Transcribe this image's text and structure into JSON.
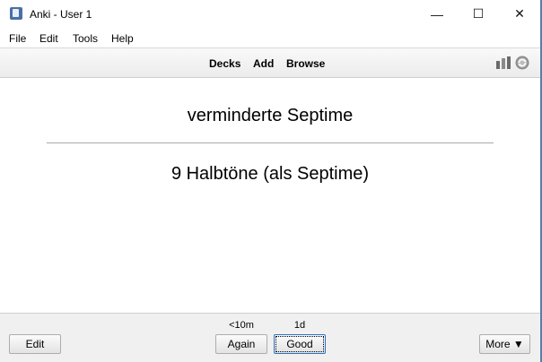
{
  "window": {
    "title": "Anki - User 1",
    "icons": {
      "app": "anki-icon",
      "minimize": "minimize-icon",
      "maximize": "maximize-icon",
      "close": "close-icon"
    },
    "controls": {
      "minimize": "—",
      "maximize": "☐",
      "close": "✕"
    }
  },
  "menu": {
    "file": "File",
    "edit": "Edit",
    "tools": "Tools",
    "help": "Help"
  },
  "toolbar": {
    "decks": "Decks",
    "add": "Add",
    "browse": "Browse",
    "stats_icon": "stats-icon",
    "sync_icon": "sync-icon"
  },
  "card": {
    "front": "verminderte Septime",
    "back": "9 Halbtöne (als Septime)"
  },
  "bottom": {
    "edit": "Edit",
    "again": {
      "label": "Again",
      "interval": "<10m"
    },
    "good": {
      "label": "Good",
      "interval": "1d"
    },
    "more": "More ▼"
  },
  "colors": {
    "window_edge": "#5a7ea8",
    "focus": "#2b74c4"
  }
}
